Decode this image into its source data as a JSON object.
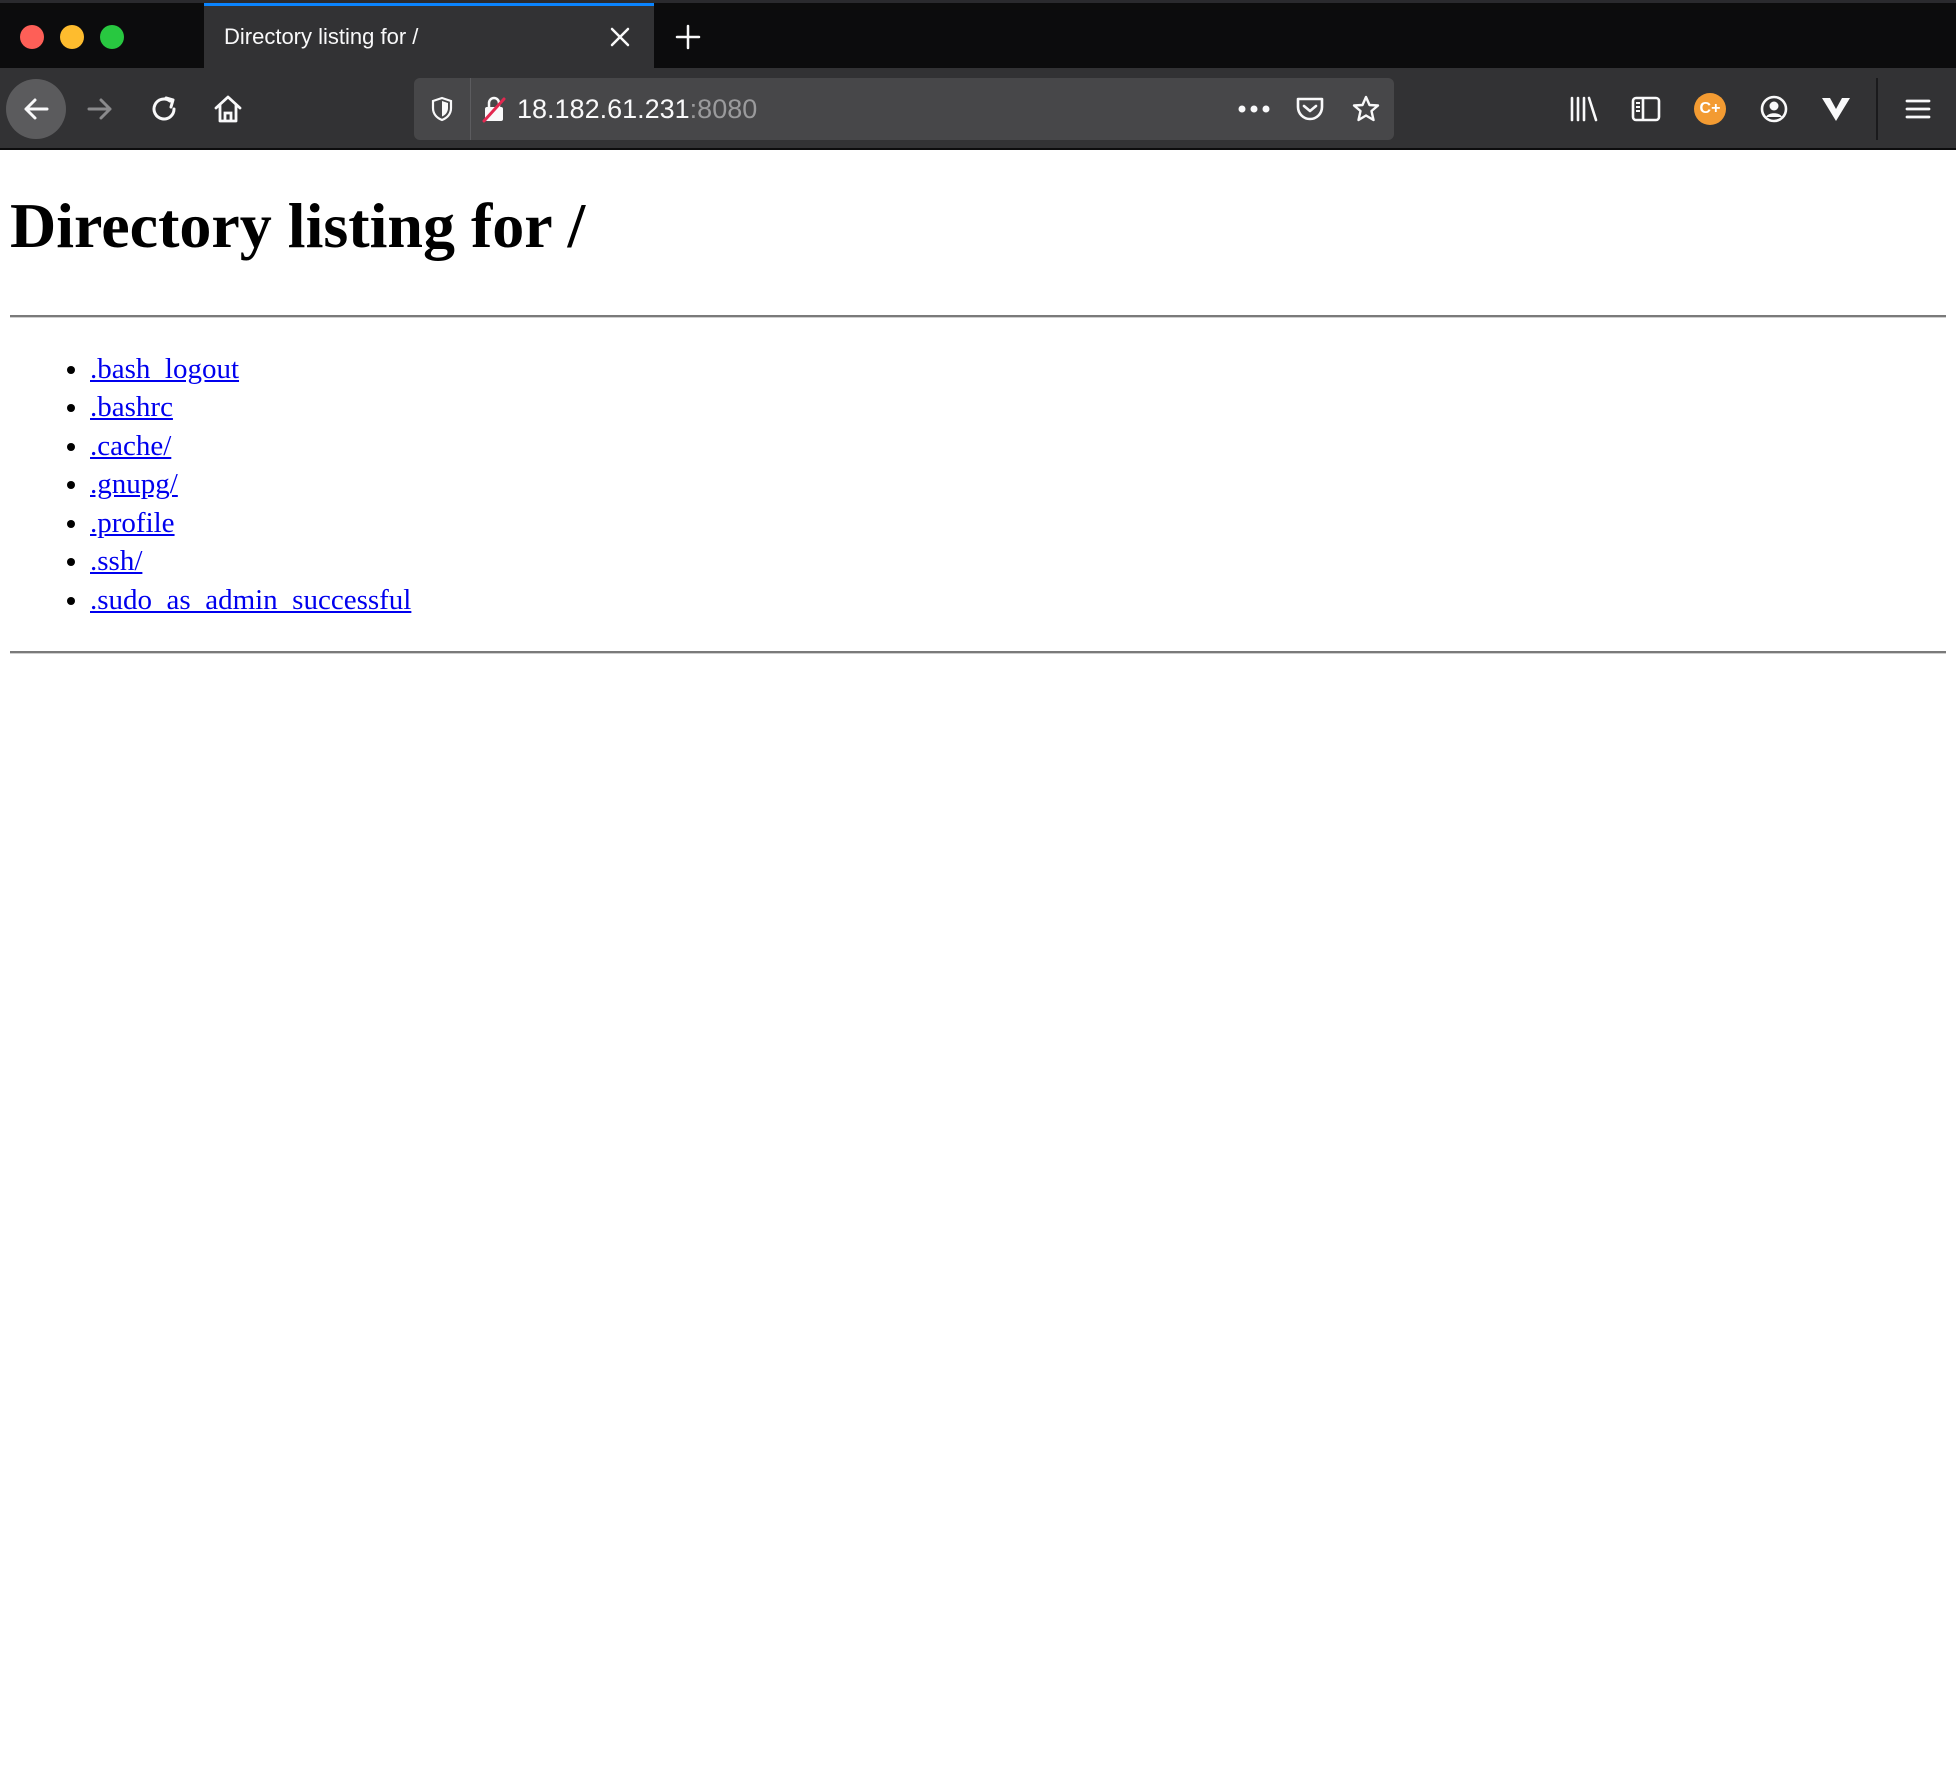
{
  "browser": {
    "tab_title": "Directory listing for /",
    "url_host": "18.182.61.231",
    "url_port": ":8080",
    "extension_badge": "C+"
  },
  "page": {
    "heading": "Directory listing for /",
    "entries": [
      ".bash_logout",
      ".bashrc",
      ".cache/",
      ".gnupg/",
      ".profile",
      ".ssh/",
      ".sudo_as_admin_successful"
    ]
  }
}
